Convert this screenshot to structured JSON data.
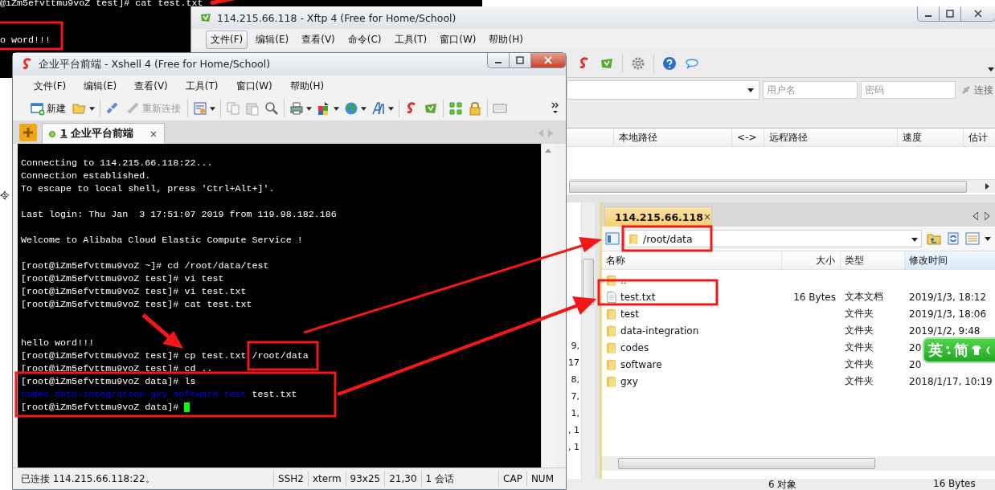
{
  "background_terminal": {
    "lines": [
      "@iZm5efvttmu9voZ test]# cat test.txt",
      "o word!!!"
    ]
  },
  "desktop_fragment": {
    "text": "令"
  },
  "xftp": {
    "title": "114.215.66.118 - Xftp 4 (Free for Home/School)",
    "menu": [
      {
        "label": "文件(F)",
        "selected": true
      },
      {
        "label": "编辑(E)",
        "selected": false
      },
      {
        "label": "查看(V)",
        "selected": false
      },
      {
        "label": "命令(C)",
        "selected": false
      },
      {
        "label": "工具(T)",
        "selected": false
      },
      {
        "label": "窗口(W)",
        "selected": false
      },
      {
        "label": "帮助(H)",
        "selected": false
      }
    ],
    "address_bar": {
      "username_placeholder": "用户名",
      "password_placeholder": "密码",
      "connect_button": "连接"
    },
    "transfer_columns": [
      "本地路径",
      "<->",
      "远程路径",
      "速度",
      "估计"
    ],
    "local_pane": {
      "date_fragments": [
        "9,",
        "17",
        "8,",
        "7,",
        "1,",
        ", 1",
        ", 1"
      ]
    },
    "remote_pane": {
      "tab": {
        "label": "114.215.66.118",
        "close": "×",
        "selected": true
      },
      "path": "/root/data",
      "columns": [
        "名称",
        "大小",
        "类型",
        "修改时间"
      ],
      "rows": [
        {
          "kind": "folder",
          "name": ".."
        },
        {
          "kind": "file",
          "name": "test.txt",
          "size": "16 Bytes",
          "type": "文本文档",
          "modified": "2019/1/3, 18:12"
        },
        {
          "kind": "folder",
          "name": "test",
          "type": "文件夹",
          "modified": "2019/1/3, 18:06"
        },
        {
          "kind": "folder",
          "name": "data-integration",
          "type": "文件夹",
          "modified": "2019/1/2, 9:48"
        },
        {
          "kind": "folder",
          "name": "codes",
          "type": "文件夹",
          "modified": "20"
        },
        {
          "kind": "folder",
          "name": "software",
          "type": "文件夹",
          "modified": "20"
        },
        {
          "kind": "folder",
          "name": "gxy",
          "type": "文件夹",
          "modified": "2018/1/17, 10:19"
        }
      ]
    },
    "status_bar": {
      "objects": "6 对象",
      "size": "16 Bytes"
    }
  },
  "ime_indicator": {
    "language": "英",
    "mode": "简"
  },
  "xshell": {
    "title": "企业平台前端 - Xshell 4 (Free for Home/School)",
    "menu": [
      "文件(F)",
      "编辑(E)",
      "查看(V)",
      "工具(T)",
      "窗口(W)",
      "帮助(H)"
    ],
    "toolbar": [
      {
        "label": "新建",
        "disabled": false
      },
      {
        "label": "重新连接",
        "disabled": true
      }
    ],
    "session_tab": {
      "number": "1",
      "label": "企业平台前端",
      "close": "×",
      "connected": true,
      "selected": true
    },
    "terminal_lines": [
      {
        "kind": "output",
        "text": "Connecting to 114.215.66.118:22..."
      },
      {
        "kind": "output",
        "text": "Connection established."
      },
      {
        "kind": "output",
        "text": "To escape to local shell, press 'Ctrl+Alt+]'."
      },
      {
        "kind": "blank"
      },
      {
        "kind": "output",
        "text": "Last login: Thu Jan  3 17:51:07 2019 from 119.98.182.186"
      },
      {
        "kind": "blank"
      },
      {
        "kind": "output",
        "text": "Welcome to Alibaba Cloud Elastic Compute Service !"
      },
      {
        "kind": "blank"
      },
      {
        "kind": "output",
        "text": "[root@iZm5efvttmu9voZ ~]# cd /root/data/test"
      },
      {
        "kind": "output",
        "text": "[root@iZm5efvttmu9voZ test]# vi test"
      },
      {
        "kind": "output",
        "text": "[root@iZm5efvttmu9voZ test]# vi test.txt"
      },
      {
        "kind": "output",
        "text": "[root@iZm5efvttmu9voZ test]# cat test.txt"
      },
      {
        "kind": "blank"
      },
      {
        "kind": "blank"
      },
      {
        "kind": "output",
        "text": "hello word!!!"
      },
      {
        "kind": "output",
        "text": "[root@iZm5efvttmu9voZ test]# cp test.txt /root/data"
      },
      {
        "kind": "output",
        "text": "[root@iZm5efvttmu9voZ test]# cd .."
      },
      {
        "kind": "output",
        "text": "[root@iZm5efvttmu9voZ data]# ls"
      },
      {
        "kind": "listing",
        "entries": [
          {
            "text": "codes",
            "kind": "directory"
          },
          {
            "text": "data-integration",
            "kind": "directory"
          },
          {
            "text": "gxy",
            "kind": "directory"
          },
          {
            "text": "software",
            "kind": "directory"
          },
          {
            "text": "test",
            "kind": "directory"
          },
          {
            "text": "test.txt",
            "kind": "file"
          }
        ]
      },
      {
        "kind": "prompt",
        "text": "[root@iZm5efvttmu9voZ data]# ",
        "cursor": true
      }
    ],
    "status_bar": [
      "已连接 114.215.66.118:22。",
      "SSH2",
      "xterm",
      "93x25",
      "21,30",
      "1 会话",
      "CAP",
      "NUM"
    ]
  }
}
